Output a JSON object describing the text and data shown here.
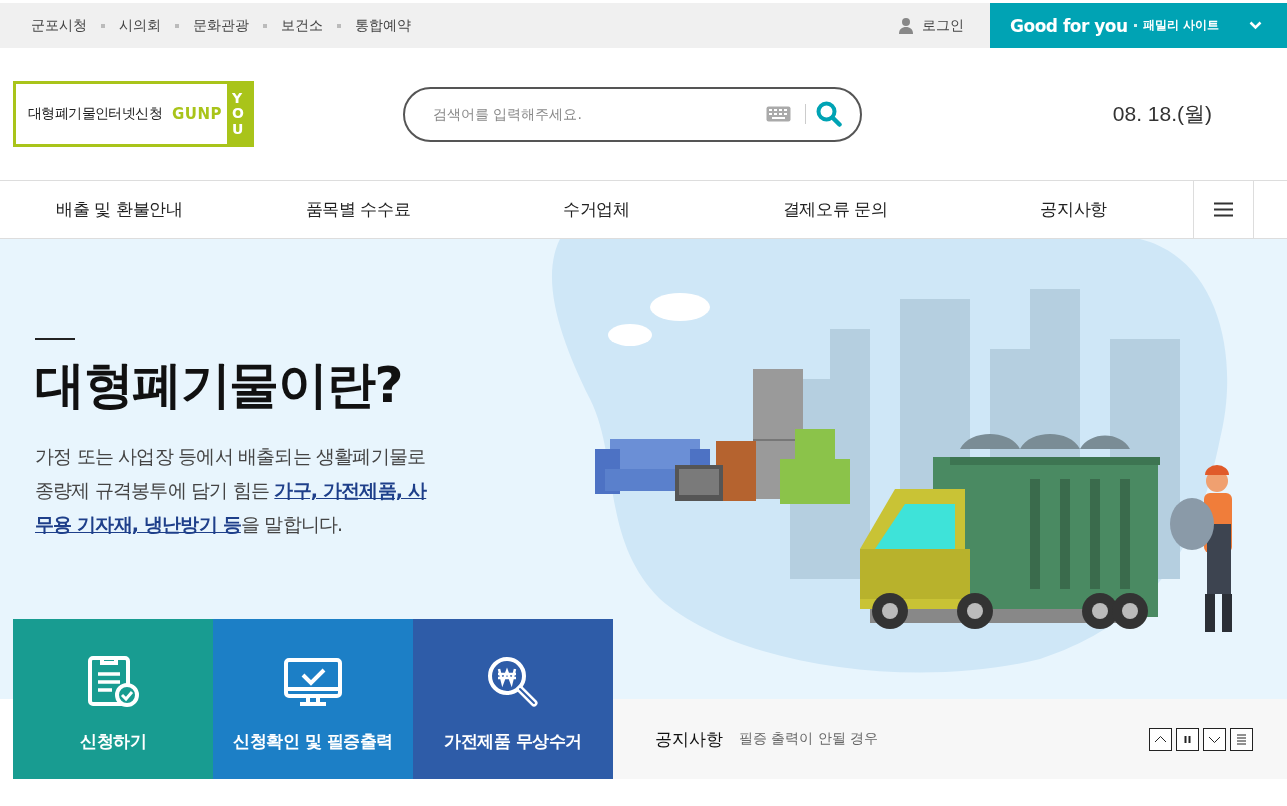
{
  "top_links": [
    "군포시청",
    "시의회",
    "문화관광",
    "보건소",
    "통합예약"
  ],
  "login": "로그인",
  "family_site": {
    "brand": "Good for you",
    "label": "패밀리 사이트"
  },
  "logo": {
    "title": "대형폐기물인터넷신청",
    "brand": "GUNP",
    "brand_vertical": "YOU"
  },
  "search": {
    "placeholder": "검색어를 입력해주세요."
  },
  "date": "08. 18.(월)",
  "nav": [
    "배출 및 환불안내",
    "품목별 수수료",
    "수거업체",
    "결제오류 문의",
    "공지사항"
  ],
  "hero": {
    "title": "대형폐기물이란?",
    "description": "가정 또는 사업장 등에서 배출되는 생활폐기물로 종량제 규격봉투에 담기 힘든 **가구, 가전제품, 사무용 기자재, 냉난방기 등**을 말합니다."
  },
  "quick_links": [
    {
      "label": "신청하기",
      "kind": "form",
      "color": "#189c91"
    },
    {
      "label": "신청확인 및 필증출력",
      "kind": "monitor",
      "color": "#1c7fc6"
    },
    {
      "label": "가전제품 무상수거",
      "kind": "search",
      "color": "#2e5ca8"
    }
  ],
  "notice": {
    "heading": "공지사항",
    "text": "필증 출력이 안될 경우"
  }
}
